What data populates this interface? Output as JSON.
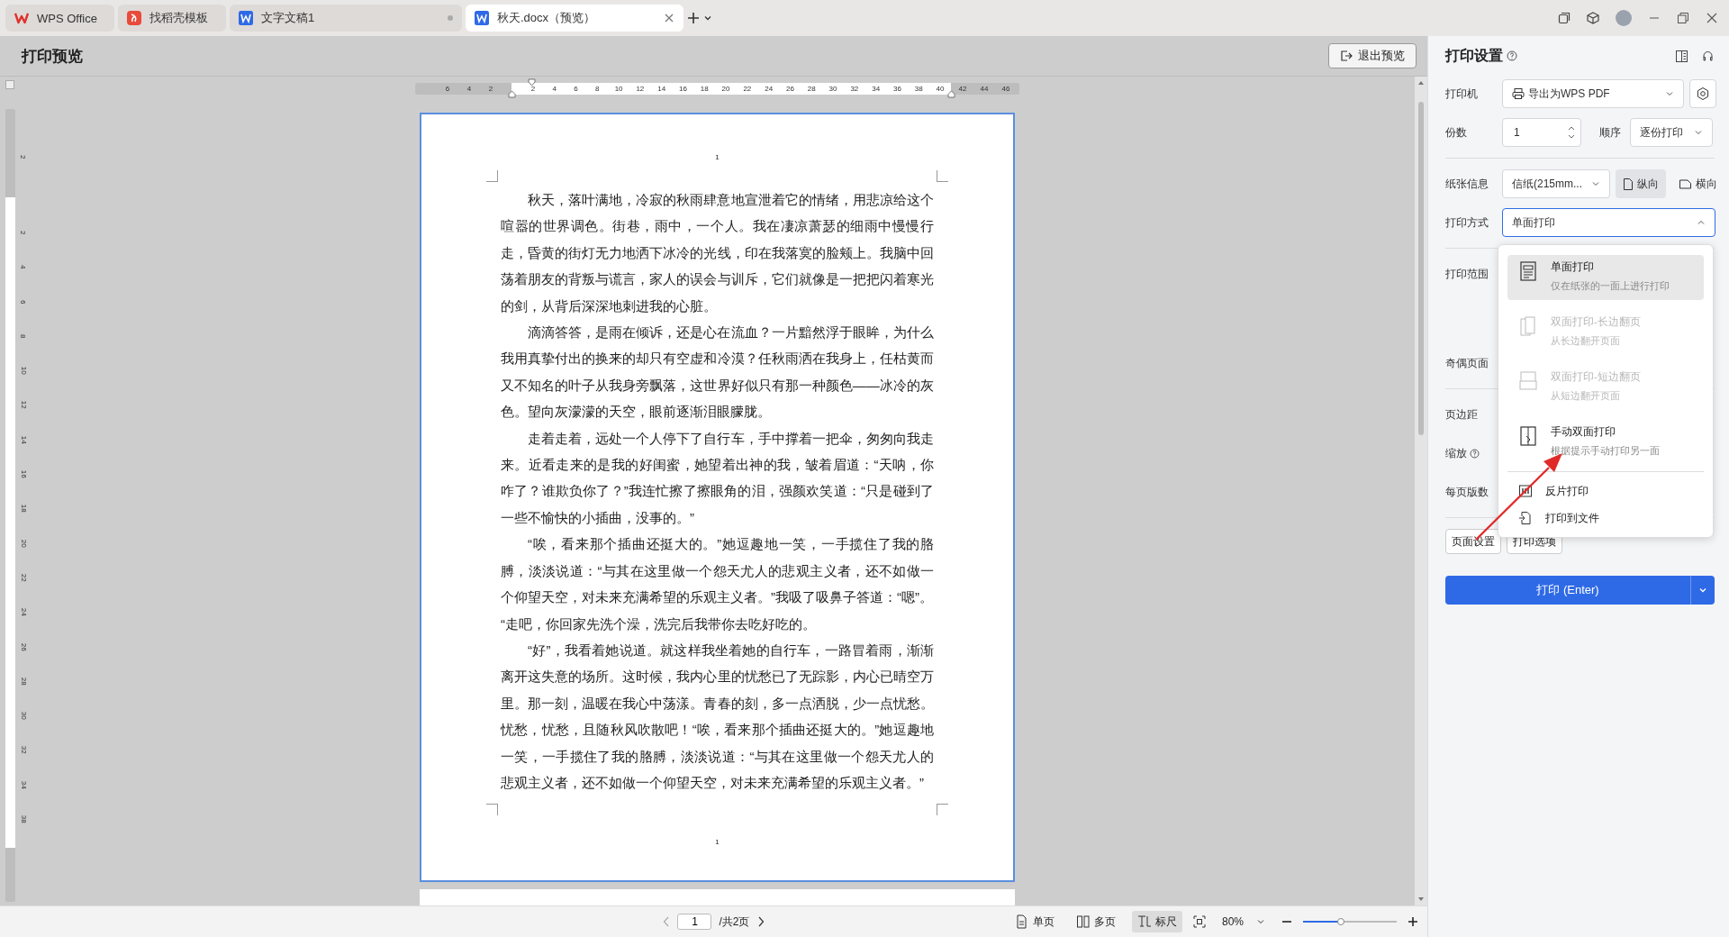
{
  "tabs": [
    {
      "label": "WPS Office",
      "kind": "home",
      "selected": false,
      "modified": false
    },
    {
      "label": "找稻壳模板",
      "kind": "templates",
      "selected": false,
      "modified": false
    },
    {
      "label": "文字文稿1",
      "kind": "document",
      "selected": false,
      "modified": true
    },
    {
      "label": "秋天.docx（预览）",
      "kind": "document",
      "selected": true,
      "modified": false
    }
  ],
  "header": {
    "title": "打印预览",
    "exit_button": "退出预览"
  },
  "horizontal_ruler": {
    "left_margin_ticks": [
      "6",
      "4",
      "2"
    ],
    "ticks": [
      "2",
      "4",
      "6",
      "8",
      "10",
      "12",
      "14",
      "16",
      "18",
      "20",
      "22",
      "24",
      "26",
      "28",
      "30",
      "32",
      "34",
      "36",
      "38",
      "40"
    ],
    "right_margin_ticks": [
      "42",
      "44",
      "46"
    ]
  },
  "vertical_ruler": {
    "top_margin_ticks": [
      "2"
    ],
    "ticks": [
      "2",
      "4",
      "6",
      "8",
      "10",
      "12",
      "14",
      "16",
      "18",
      "20",
      "22",
      "24",
      "26",
      "28",
      "30",
      "32",
      "34",
      "38"
    ]
  },
  "document": {
    "header_page_number": "1",
    "footer_page_number": "1",
    "paragraphs": [
      {
        "indent": true,
        "text": "秋天，落叶满地，冷寂的秋雨肆意地宣泄着它的情绪，用悲凉给这个喧嚣的世界调色。街巷，雨中，一个人。我在凄凉萧瑟的细雨中慢慢行走，昏黄的街灯无力地洒下冰冷的光线，印在我落寞的脸颊上。我脑中回荡着朋友的背叛与谎言，家人的误会与训斥，它们就像是一把把闪着寒光的剑，从背后深深地刺进我的心脏。"
      },
      {
        "indent": true,
        "text": "滴滴答答，是雨在倾诉，还是心在流血？一片黯然浮于眼眸，为什么我用真挚付出的换来的却只有空虚和冷漠？任秋雨洒在我身上，任枯黄而又不知名的叶子从我身旁飘落，这世界好似只有那一种颜色——冰冷的灰色。望向灰濛濛的天空，眼前逐渐泪眼朦胧。"
      },
      {
        "indent": true,
        "text": "走着走着，远处一个人停下了自行车，手中撑着一把伞，匆匆向我走来。近看走来的是我的好闺蜜，她望着出神的我，皱着眉道：“天呐，你咋了？谁欺负你了？”我连忙擦了擦眼角的泪，强颜欢笑道：“只是碰到了一些不愉快的小插曲，没事的。”"
      },
      {
        "indent": true,
        "text": "“唉，看来那个插曲还挺大的。”她逗趣地一笑，一手揽住了我的胳膊，淡淡说道：“与其在这里做一个怨天尤人的悲观主义者，还不如做一个仰望天空，对未来充满希望的乐观主义者。”我吸了吸鼻子答道：“嗯”。"
      },
      {
        "indent": false,
        "text": "“走吧，你回家先洗个澡，洗完后我带你去吃好吃的。"
      },
      {
        "indent": true,
        "text": "“好”，我看着她说道。就这样我坐着她的自行车，一路冒着雨，渐渐离开这失意的场所。这时候，我内心里的忧愁已了无踪影，内心已晴空万里。那一刻，温暖在我心中荡漾。青春的刻，多一点洒脱，少一点忧愁。忧愁，忧愁，且随秋风吹散吧！“唉，看来那个插曲还挺大的。”她逗趣地一笑，一手揽住了我的胳膊，淡淡说道：“与其在这里做一个怨天尤人的悲观主义者，还不如做一个仰望天空，对未来充满希望的乐观主义者。”"
      }
    ]
  },
  "status_bar": {
    "page_input": "1",
    "page_total": "/共2页",
    "view_buttons": [
      {
        "label": "单页",
        "selected": false
      },
      {
        "label": "多页",
        "selected": false
      },
      {
        "label": "标尺",
        "selected": true
      }
    ],
    "zoom": "80%",
    "zoom_slider": {
      "level": 0.4
    }
  },
  "print_panel": {
    "title": "打印设置",
    "sections": [
      [
        {
          "kind": "printer",
          "label": "打印机",
          "value": "导出为WPS PDF"
        },
        {
          "kind": "copies",
          "label": "份数",
          "value": "1",
          "order_label": "顺序",
          "order_value": "逐份打印"
        }
      ],
      [
        {
          "kind": "paper",
          "label": "纸张信息",
          "value": "信纸(215mm...",
          "orientations": [
            {
              "label": "纵向",
              "selected": true
            },
            {
              "label": "横向",
              "selected": false
            }
          ]
        },
        {
          "kind": "mode",
          "label": "打印方式",
          "value": "单面打印",
          "expanded": true
        }
      ],
      [
        {
          "kind": "plain",
          "label": "打印范围"
        },
        {
          "kind": "plain",
          "label": "奇偶页面"
        }
      ],
      [
        {
          "kind": "plain",
          "label": "页边距"
        },
        {
          "kind": "help",
          "label": "缩放"
        },
        {
          "kind": "plain",
          "label": "每页版数"
        }
      ]
    ],
    "buttons": [
      "页面设置",
      "打印选项"
    ],
    "print_button": "打印 (Enter)",
    "mode_menu": {
      "options": [
        {
          "title": "单面打印",
          "subtitle": "仅在纸张的一面上进行打印",
          "selected": true,
          "disabled": false
        },
        {
          "title": "双面打印-长边翻页",
          "subtitle": "从长边翻开页面",
          "selected": false,
          "disabled": true
        },
        {
          "title": "双面打印-短边翻页",
          "subtitle": "从短边翻开页面",
          "selected": false,
          "disabled": true
        },
        {
          "title": "手动双面打印",
          "subtitle": "根据提示手动打印另一面",
          "selected": false,
          "disabled": false
        }
      ],
      "actions": [
        "反片打印",
        "打印到文件"
      ]
    }
  }
}
